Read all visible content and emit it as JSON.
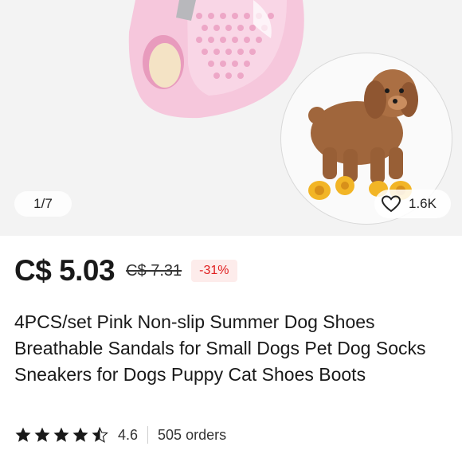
{
  "gallery": {
    "counter": "1/7",
    "wishlist_count": "1.6K"
  },
  "product": {
    "price": "C$ 5.03",
    "original_price": "C$ 7.31",
    "discount": "-31%",
    "title": "4PCS/set Pink Non-slip Summer Dog Shoes Breathable Sandals for Small Dogs Pet Dog Socks Sneakers for Dogs Puppy Cat Shoes Boots",
    "rating": 4.6,
    "rating_label": "4.6",
    "orders": "505 orders"
  },
  "colors": {
    "price_text": "#191919",
    "discount_text": "#e02020",
    "discount_bg": "#fdeceb",
    "star": "#191919",
    "shoe_pink": "#f4bcd6"
  },
  "icons": [
    "pink-dog-shoe-image",
    "poodle-dog-image",
    "heart-icon",
    "star-icon"
  ]
}
